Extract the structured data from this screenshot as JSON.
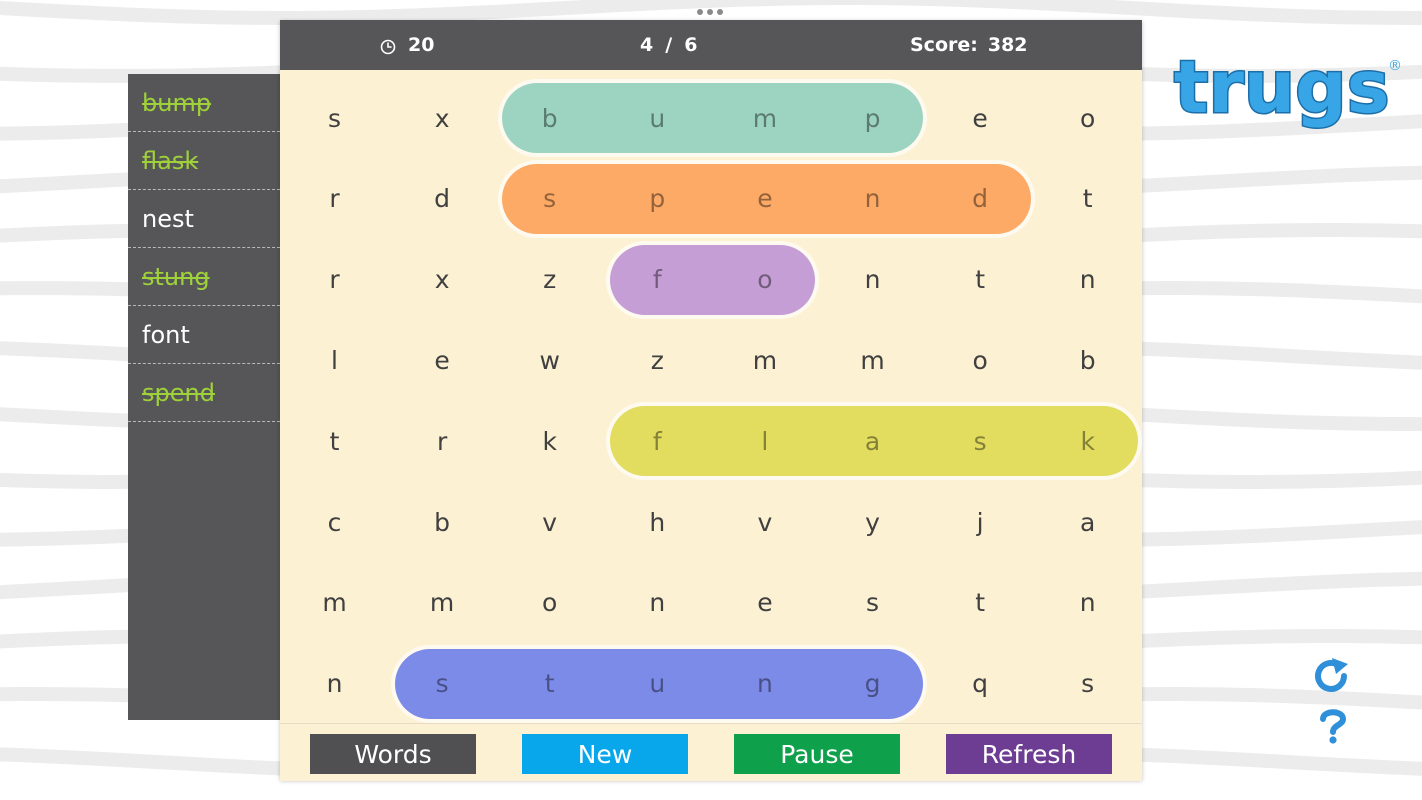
{
  "colors": {
    "found_word": "#9fd13a",
    "panel": "#565658",
    "board": "#fdf1d3",
    "highlight_bump": "#9dd4c1",
    "highlight_spend": "#fdaa66",
    "highlight_fo": "#c49ed5",
    "highlight_flask": "#e2dc5f",
    "highlight_stung": "#7d8be8",
    "logo": "#38a6e6"
  },
  "header": {
    "timer_icon": "clock-icon",
    "timer_value": "20",
    "progress_found": "4",
    "progress_sep": "/",
    "progress_total": "6",
    "score_label": "Score:",
    "score_value": "382"
  },
  "words": [
    {
      "text": "bump",
      "found": true
    },
    {
      "text": "flask",
      "found": true
    },
    {
      "text": "nest",
      "found": false
    },
    {
      "text": "stung",
      "found": true
    },
    {
      "text": "font",
      "found": false
    },
    {
      "text": "spend",
      "found": true
    }
  ],
  "grid": [
    [
      "s",
      "x",
      "b",
      "u",
      "m",
      "p",
      "e",
      "o"
    ],
    [
      "r",
      "d",
      "s",
      "p",
      "e",
      "n",
      "d",
      "t"
    ],
    [
      "r",
      "x",
      "z",
      "f",
      "o",
      "n",
      "t",
      "n"
    ],
    [
      "l",
      "e",
      "w",
      "z",
      "m",
      "m",
      "o",
      "b"
    ],
    [
      "t",
      "r",
      "k",
      "f",
      "l",
      "a",
      "s",
      "k"
    ],
    [
      "c",
      "b",
      "v",
      "h",
      "v",
      "y",
      "j",
      "a"
    ],
    [
      "m",
      "m",
      "o",
      "n",
      "e",
      "s",
      "t",
      "n"
    ],
    [
      "n",
      "s",
      "t",
      "u",
      "n",
      "g",
      "q",
      "s"
    ]
  ],
  "highlights": [
    {
      "word": "bump",
      "row": 0,
      "col_start": 2,
      "col_end": 5,
      "color": "#9dd4c1"
    },
    {
      "word": "spend",
      "row": 1,
      "col_start": 2,
      "col_end": 6,
      "color": "#fdaa66"
    },
    {
      "word": "fo",
      "row": 2,
      "col_start": 3,
      "col_end": 4,
      "color": "#c49ed5"
    },
    {
      "word": "flask",
      "row": 4,
      "col_start": 3,
      "col_end": 7,
      "color": "#e2dc5f"
    },
    {
      "word": "stung",
      "row": 7,
      "col_start": 1,
      "col_end": 5,
      "color": "#7d8be8"
    }
  ],
  "buttons": [
    {
      "label": "Words",
      "color": "#505052"
    },
    {
      "label": "New",
      "color": "#08a7eb"
    },
    {
      "label": "Pause",
      "color": "#0ea04a"
    },
    {
      "label": "Refresh",
      "color": "#6d3c93"
    }
  ],
  "logo": {
    "text": "trugs",
    "mark": "®"
  },
  "side_icons": [
    "refresh-icon",
    "help-icon"
  ]
}
